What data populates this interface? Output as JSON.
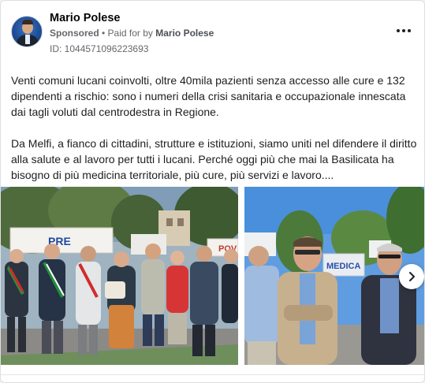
{
  "post": {
    "author": "Mario Polese",
    "sponsored": "Sponsored",
    "paid_for_prefix": " • Paid for by ",
    "paid_for_name": "Mario Polese",
    "ad_id": "ID: 1044571096223693",
    "paragraphs": [
      "Venti comuni lucani coinvolti, oltre 40mila pazienti senza accesso alle cure e 132 dipendenti a rischio: sono i numeri della crisi sanitaria e occupazionale innescata dai tagli voluti dal centrodestra in Regione.",
      "Da Melfi, a fianco di cittadini, strutture e istituzioni, siamo uniti nel difendere il diritto alla salute e al lavoro per tutti i lucani. Perché oggi più che mai la Basilicata ha bisogno di più medicina territoriale, più cure, più servizi e lavoro...."
    ],
    "banner_text_left": "PRE",
    "banner_text_right": "POV",
    "banner_text_photo2": "MEDICA"
  },
  "icons": {
    "more": "more-horizontal-icon",
    "next": "chevron-right-icon"
  },
  "colors": {
    "secondary_text": "#65676b",
    "sky": "#5f9de0",
    "card_border": "#dddfe2"
  }
}
